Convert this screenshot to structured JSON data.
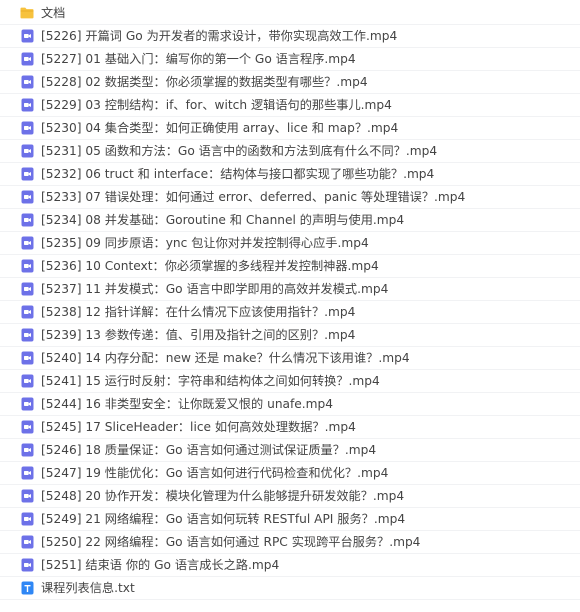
{
  "colors": {
    "folder": "#f7c23d",
    "video": "#6d71e8",
    "text_file": "#2f87f5"
  },
  "items": [
    {
      "type": "folder",
      "icon": "folder-icon",
      "name": "文档"
    },
    {
      "type": "video",
      "icon": "video-file-icon",
      "name": "[5226] 开篇词 Go 为开发者的需求设计，带你实现高效工作.mp4"
    },
    {
      "type": "video",
      "icon": "video-file-icon",
      "name": "[5227] 01 基础入门：编写你的第一个 Go 语言程序.mp4"
    },
    {
      "type": "video",
      "icon": "video-file-icon",
      "name": "[5228] 02 数据类型：你必须掌握的数据类型有哪些？.mp4"
    },
    {
      "type": "video",
      "icon": "video-file-icon",
      "name": "[5229] 03 控制结构：if、for、witch 逻辑语句的那些事儿.mp4"
    },
    {
      "type": "video",
      "icon": "video-file-icon",
      "name": "[5230] 04 集合类型：如何正确使用 array、lice 和 map？.mp4"
    },
    {
      "type": "video",
      "icon": "video-file-icon",
      "name": "[5231] 05 函数和方法：Go 语言中的函数和方法到底有什么不同？.mp4"
    },
    {
      "type": "video",
      "icon": "video-file-icon",
      "name": "[5232] 06 truct 和 interface：结构体与接口都实现了哪些功能？.mp4"
    },
    {
      "type": "video",
      "icon": "video-file-icon",
      "name": "[5233] 07 错误处理：如何通过 error、deferred、panic 等处理错误？.mp4"
    },
    {
      "type": "video",
      "icon": "video-file-icon",
      "name": "[5234] 08 并发基础：Goroutine 和 Channel 的声明与使用.mp4"
    },
    {
      "type": "video",
      "icon": "video-file-icon",
      "name": "[5235] 09 同步原语：ync 包让你对并发控制得心应手.mp4"
    },
    {
      "type": "video",
      "icon": "video-file-icon",
      "name": "[5236] 10 Context：你必须掌握的多线程并发控制神器.mp4"
    },
    {
      "type": "video",
      "icon": "video-file-icon",
      "name": "[5237] 11 并发模式：Go 语言中即学即用的高效并发模式.mp4"
    },
    {
      "type": "video",
      "icon": "video-file-icon",
      "name": "[5238] 12 指针详解：在什么情况下应该使用指针？.mp4"
    },
    {
      "type": "video",
      "icon": "video-file-icon",
      "name": "[5239] 13 参数传递：值、引用及指针之间的区别？.mp4"
    },
    {
      "type": "video",
      "icon": "video-file-icon",
      "name": "[5240] 14 内存分配：new 还是 make？什么情况下该用谁？.mp4"
    },
    {
      "type": "video",
      "icon": "video-file-icon",
      "name": "[5241] 15 运行时反射：字符串和结构体之间如何转换？.mp4"
    },
    {
      "type": "video",
      "icon": "video-file-icon",
      "name": "[5244] 16 非类型安全：让你既爱又恨的 unafe.mp4"
    },
    {
      "type": "video",
      "icon": "video-file-icon",
      "name": "[5245] 17 SliceHeader：lice 如何高效处理数据？.mp4"
    },
    {
      "type": "video",
      "icon": "video-file-icon",
      "name": "[5246] 18 质量保证：Go 语言如何通过测试保证质量？.mp4"
    },
    {
      "type": "video",
      "icon": "video-file-icon",
      "name": "[5247] 19 性能优化：Go 语言如何进行代码检查和优化？.mp4"
    },
    {
      "type": "video",
      "icon": "video-file-icon",
      "name": "[5248] 20 协作开发：模块化管理为什么能够提升研发效能？.mp4"
    },
    {
      "type": "video",
      "icon": "video-file-icon",
      "name": "[5249] 21 网络编程：Go 语言如何玩转 RESTful API 服务？.mp4"
    },
    {
      "type": "video",
      "icon": "video-file-icon",
      "name": "[5250] 22 网络编程：Go 语言如何通过 RPC 实现跨平台服务？.mp4"
    },
    {
      "type": "video",
      "icon": "video-file-icon",
      "name": "[5251] 结束语 你的 Go 语言成长之路.mp4"
    },
    {
      "type": "text",
      "icon": "text-file-icon",
      "name": "课程列表信息.txt"
    }
  ]
}
